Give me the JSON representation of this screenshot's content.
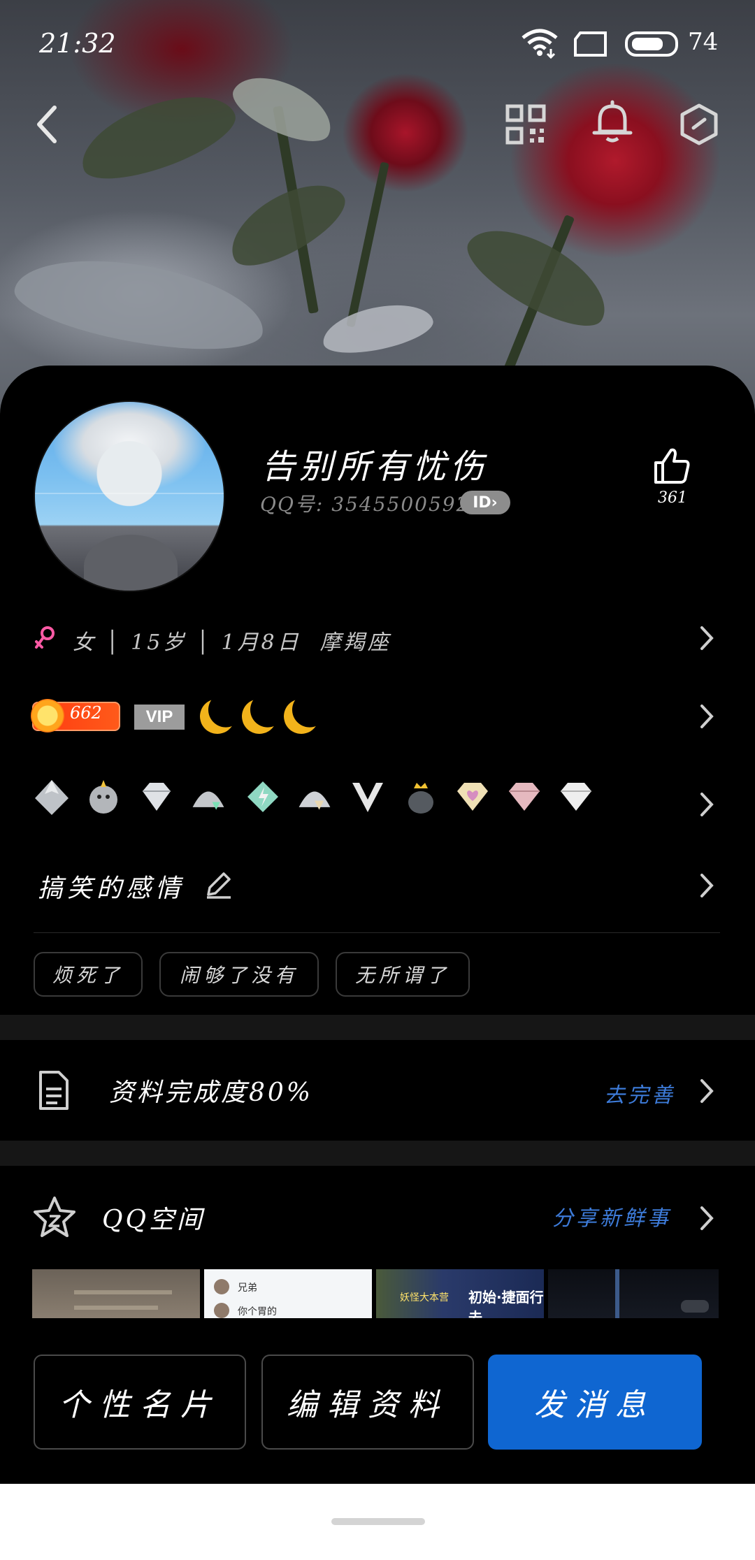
{
  "status_bar": {
    "time": "21:32",
    "battery_percent": "74",
    "icons": [
      "wifi-icon",
      "sim-icon",
      "battery-icon"
    ]
  },
  "header": {
    "icons": [
      "back-icon",
      "qr-code-icon",
      "bell-icon",
      "settings-hexagon-icon"
    ]
  },
  "profile": {
    "name": "告别所有忧伤",
    "qq_label": "QQ号: 3545500592",
    "id_badge": "ID›",
    "like_count": "361"
  },
  "info_row": {
    "text": "女 │ 15岁 │ 1月8日  摩羯座",
    "gender_color": "#ff5aa5"
  },
  "level_row": {
    "level": "662",
    "vip_label": "VIP",
    "moon_count": 3
  },
  "badges": {
    "items": [
      "silver-crown-icon",
      "penguin-icon",
      "diamond-icon",
      "penguin-hat-icon",
      "lightning-gem-icon",
      "penguin-gem-icon",
      "v-badge-icon",
      "penguin-crown-icon",
      "heart-gem-icon",
      "pink-diamond-icon",
      "white-diamond-icon"
    ]
  },
  "signature": {
    "text": "搞笑的感情"
  },
  "tags": [
    "烦死了",
    "闹够了没有",
    "无所谓了"
  ],
  "profile_completion": {
    "title": "资料完成度80%",
    "action": "去完善"
  },
  "qzone": {
    "title": "QQ空间",
    "action": "分享新鲜事",
    "thumb_texts": [
      "",
      "兄弟",
      "",
      ""
    ],
    "thumb2_line2": "你个胃的",
    "thumb3_text": "妖怪大本营",
    "thumb3_caption": "初始·捷面行去"
  },
  "actions": {
    "card": "个性名片",
    "edit": "编辑资料",
    "message": "发消息",
    "accent_color": "#0f66d1"
  }
}
